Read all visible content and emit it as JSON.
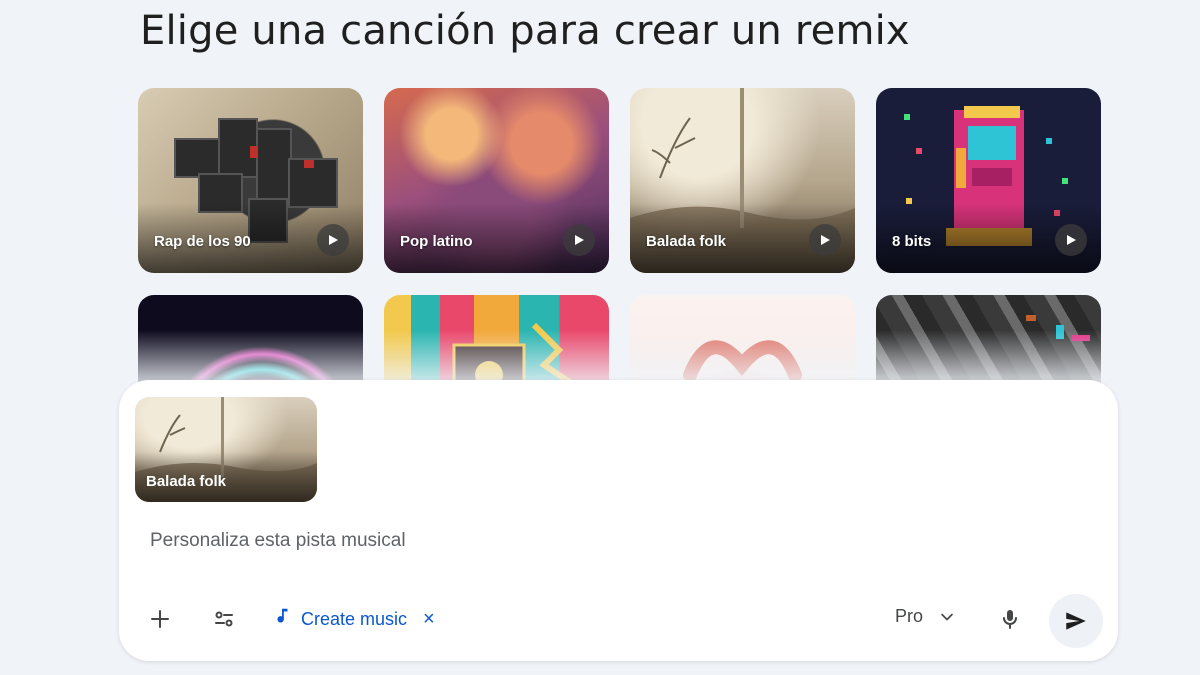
{
  "heading": "Elige una canción para crear un remix",
  "cards": [
    {
      "label": "Rap de los 90"
    },
    {
      "label": "Pop latino"
    },
    {
      "label": "Balada folk"
    },
    {
      "label": "8 bits"
    }
  ],
  "panel": {
    "attached_label": "Balada folk",
    "prompt_placeholder": "Personaliza esta pista musical",
    "chip_label": "Create music",
    "chip_remove": "×",
    "model_label": "Pro"
  },
  "colors": {
    "background": "#f0f4f9",
    "accent_blue": "#0b57d0",
    "panel": "#ffffff"
  },
  "icons": [
    "play-icon",
    "plus-icon",
    "tools-icon",
    "music-note-icon",
    "close-icon",
    "chevron-down-icon",
    "microphone-icon",
    "send-icon"
  ]
}
